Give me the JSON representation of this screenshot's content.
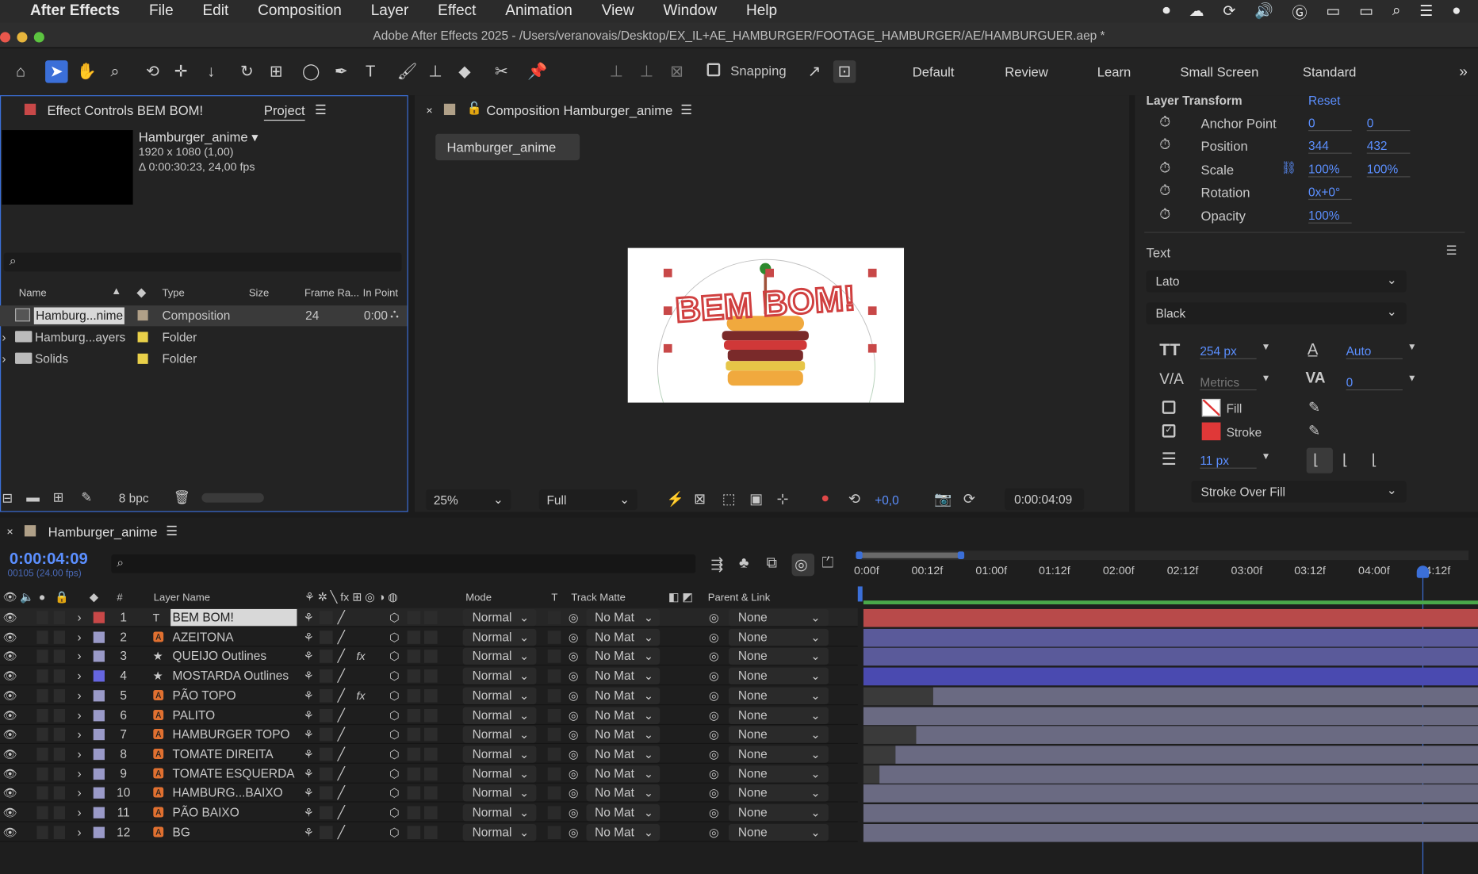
{
  "menubar": {
    "app": "After Effects",
    "items": [
      "File",
      "Edit",
      "Composition",
      "Layer",
      "Effect",
      "Animation",
      "View",
      "Window",
      "Help"
    ]
  },
  "window_title": "Adobe After Effects 2025 - /Users/veranovais/Desktop/EX_IL+AE_HAMBURGER/FOOTAGE_HAMBURGER/AE/HAMBURGUER.aep *",
  "toolbar": {
    "snapping": "Snapping",
    "workspaces": [
      "Default",
      "Review",
      "Learn",
      "Small Screen",
      "Standard"
    ]
  },
  "project": {
    "tab_effect": "Effect Controls BEM BOM!",
    "tab_project": "Project",
    "item_name": "Hamburger_anime ▾",
    "item_size": "1920 x 1080 (1,00)",
    "item_duration": "Δ 0:00:30:23, 24,00 fps",
    "columns": {
      "name": "Name",
      "type": "Type",
      "size": "Size",
      "frame": "Frame Ra...",
      "in": "In Point"
    },
    "items": [
      {
        "name": "Hamburg...nime",
        "type": "Composition",
        "frame": "24",
        "in": "0:00",
        "color": "#b0a088"
      },
      {
        "name": "Hamburg...ayers",
        "type": "Folder",
        "frame": "",
        "in": "",
        "color": "#e9d049"
      },
      {
        "name": "Solids",
        "type": "Folder",
        "frame": "",
        "in": "",
        "color": "#e9d049"
      }
    ],
    "bpc": "8 bpc"
  },
  "composition": {
    "tab": "Composition Hamburger_anime",
    "subtab": "Hamburger_anime",
    "art_text": "BEM BOM!",
    "zoom": "25%",
    "resolution": "Full",
    "exposure": "+0,0",
    "timecode": "0:00:04:09"
  },
  "properties": {
    "layer_transform": "Layer Transform",
    "reset": "Reset",
    "rows": [
      {
        "label": "Anchor Point",
        "v1": "0",
        "v2": "0"
      },
      {
        "label": "Position",
        "v1": "344",
        "v2": "432"
      },
      {
        "label": "Scale",
        "v1": "100%",
        "v2": "100%"
      },
      {
        "label": "Rotation",
        "v1": "0x+0°",
        "v2": ""
      },
      {
        "label": "Opacity",
        "v1": "100%",
        "v2": ""
      }
    ],
    "text_title": "Text",
    "font": "Lato",
    "style": "Black",
    "size": "254 px",
    "leading": "Auto",
    "kerning": "Metrics",
    "tracking": "0",
    "fill": "Fill",
    "stroke": "Stroke",
    "stroke_width": "11 px",
    "stroke_over": "Stroke Over Fill"
  },
  "timeline": {
    "tab": "Hamburger_anime",
    "timecode": "0:00:04:09",
    "frame_info": "00105 (24.00 fps)",
    "columns": {
      "name": "Layer Name",
      "mode": "Mode",
      "t": "T",
      "matte": "Track Matte",
      "parent": "Parent & Link"
    },
    "ruler": [
      "0:00f",
      "00:12f",
      "01:00f",
      "01:12f",
      "02:00f",
      "02:12f",
      "03:00f",
      "03:12f",
      "04:00f",
      "4:12f"
    ],
    "mode_val": "Normal",
    "matte_val": "No Mat",
    "parent_val": "None",
    "layers": [
      {
        "num": "1",
        "name": "BEM BOM!",
        "icon": "T",
        "label": "#c84848",
        "fx": false
      },
      {
        "num": "2",
        "name": "AZEITONA",
        "icon": "ai",
        "label": "#9a9ac8",
        "fx": false
      },
      {
        "num": "3",
        "name": "QUEIJO Outlines",
        "icon": "★",
        "label": "#9a9ac8",
        "fx": true
      },
      {
        "num": "4",
        "name": "MOSTARDA Outlines",
        "icon": "★",
        "label": "#6666e0",
        "fx": false
      },
      {
        "num": "5",
        "name": "PÃO TOPO",
        "icon": "ai",
        "label": "#9a9ac8",
        "fx": true
      },
      {
        "num": "6",
        "name": "PALITO",
        "icon": "ai",
        "label": "#9a9ac8",
        "fx": false
      },
      {
        "num": "7",
        "name": "HAMBURGER TOPO",
        "icon": "ai",
        "label": "#9a9ac8",
        "fx": false
      },
      {
        "num": "8",
        "name": "TOMATE DIREITA",
        "icon": "ai",
        "label": "#9a9ac8",
        "fx": false
      },
      {
        "num": "9",
        "name": "TOMATE ESQUERDA",
        "icon": "ai",
        "label": "#9a9ac8",
        "fx": false
      },
      {
        "num": "10",
        "name": "HAMBURG...BAIXO",
        "icon": "ai",
        "label": "#9a9ac8",
        "fx": false
      },
      {
        "num": "11",
        "name": "PÃO BAIXO",
        "icon": "ai",
        "label": "#9a9ac8",
        "fx": false
      },
      {
        "num": "12",
        "name": "BG",
        "icon": "ai",
        "label": "#9a9ac8",
        "fx": false
      }
    ]
  }
}
